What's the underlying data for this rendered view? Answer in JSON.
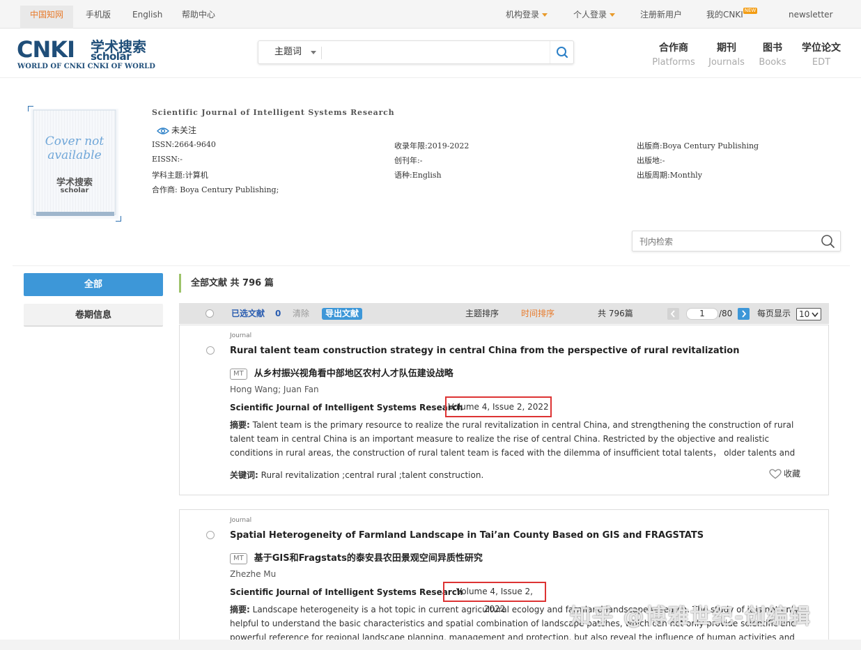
{
  "topbar": {
    "links": [
      "中国知网",
      "手机版",
      "English",
      "帮助中心"
    ],
    "institution_login": "机构登录",
    "personal_login": "个人登录",
    "register": "注册新用户",
    "my_cnki": "我的CNKI",
    "new_badge": "NEW",
    "newsletter": "newsletter"
  },
  "logo": {
    "brand": "CNKI",
    "scholar_zh": "学术搜索",
    "scholar_en": "scholar",
    "tagline": "WORLD OF CNKI CNKI OF WORLD"
  },
  "search": {
    "field_label": "主题词",
    "value": ""
  },
  "nav": [
    {
      "zh": "合作商",
      "en": "Platforms"
    },
    {
      "zh": "期刊",
      "en": "Journals"
    },
    {
      "zh": "图书",
      "en": "Books"
    },
    {
      "zh": "学位论文",
      "en": "EDT"
    }
  ],
  "journal": {
    "cover_text_1": "Cover not",
    "cover_text_2": "available",
    "cover_logo_zh": "学术搜索",
    "cover_logo_en": "scholar",
    "title": "Scientific Journal of Intelligent Systems Research",
    "follow": "未关注",
    "issn": "ISSN:2664-9640",
    "eissn": "EISSN:-",
    "subject": "学科主题:计算机",
    "partner": "合作商: Boya Century Publishing;",
    "years": "收录年限:2019-2022",
    "founded": "创刊年:-",
    "language": "语种:English",
    "publisher": "出版商:Boya Century Publishing",
    "place": "出版地:-",
    "frequency": "出版周期:Monthly"
  },
  "inner_search": {
    "placeholder": "刊内检索"
  },
  "sidebar": {
    "all": "全部",
    "volume_info": "卷期信息"
  },
  "results": {
    "header": "全部文献 共 796 篇",
    "toolbar": {
      "selected_label": "已选文献",
      "selected_count": "0",
      "clear": "清除",
      "export": "导出文献",
      "sort_topic": "主题排序",
      "sort_time": "时间排序",
      "total": "共 796篇",
      "page": "1",
      "page_total": "/80",
      "per_page_label": "每页显示",
      "per_page": "10"
    },
    "articles": [
      {
        "type": "Journal",
        "title": "Rural talent team construction strategy in central China from the perspective of rural revitalization",
        "mt_badge": "MT",
        "title_zh": "从乡村振兴视角看中部地区农村人才队伍建设战略",
        "authors": "Hong Wang; Juan Fan",
        "source": "Scientific Journal of Intelligent Systems Research",
        "volume": "Volume 4, Issue 2, 2022",
        "abstract_label": "摘要:",
        "abstract": "Talent team is the primary resource to realize the rural revitalization in central China, and strengthening the construction of rural talent team in central China is an important measure to realize the rise of central China. Restricted by the objective and realistic conditions in rural areas, the construction of rural talent team is faced with the dilemma of insufficient total talents， older talents and lower educational level. This paper firstly puts forward the problems in...",
        "keywords_label": "关键词:",
        "keywords": "Rural revitalization ;central rural ;talent construction.",
        "favorite": "收藏"
      },
      {
        "type": "Journal",
        "title": "Spatial Heterogeneity of Farmland Landscape in Tai’an County Based on GIS and FRAGSTATS",
        "mt_badge": "MT",
        "title_zh": "基于GIS和Fragstats的泰安县农田景观空间异质性研究",
        "authors": "Zhezhe Mu",
        "source": "Scientific Journal of Intelligent Systems Research",
        "volume": "Volume 4, Issue 2, 2022",
        "abstract_label": "摘要:",
        "abstract": "Landscape heterogeneity is a hot topic in current agricultural ecology and farmland landscape research. The study of it is not only helpful to understand the basic characteristics and spatial combination of landscape patches, which can not only provide scientific and powerful reference for regional landscape planning, management and protection, but also reveal the influence of human activities and natural factors on landscape pattern..."
      }
    ]
  },
  "watermark": "知乎 @博雅世纪-创编辑"
}
